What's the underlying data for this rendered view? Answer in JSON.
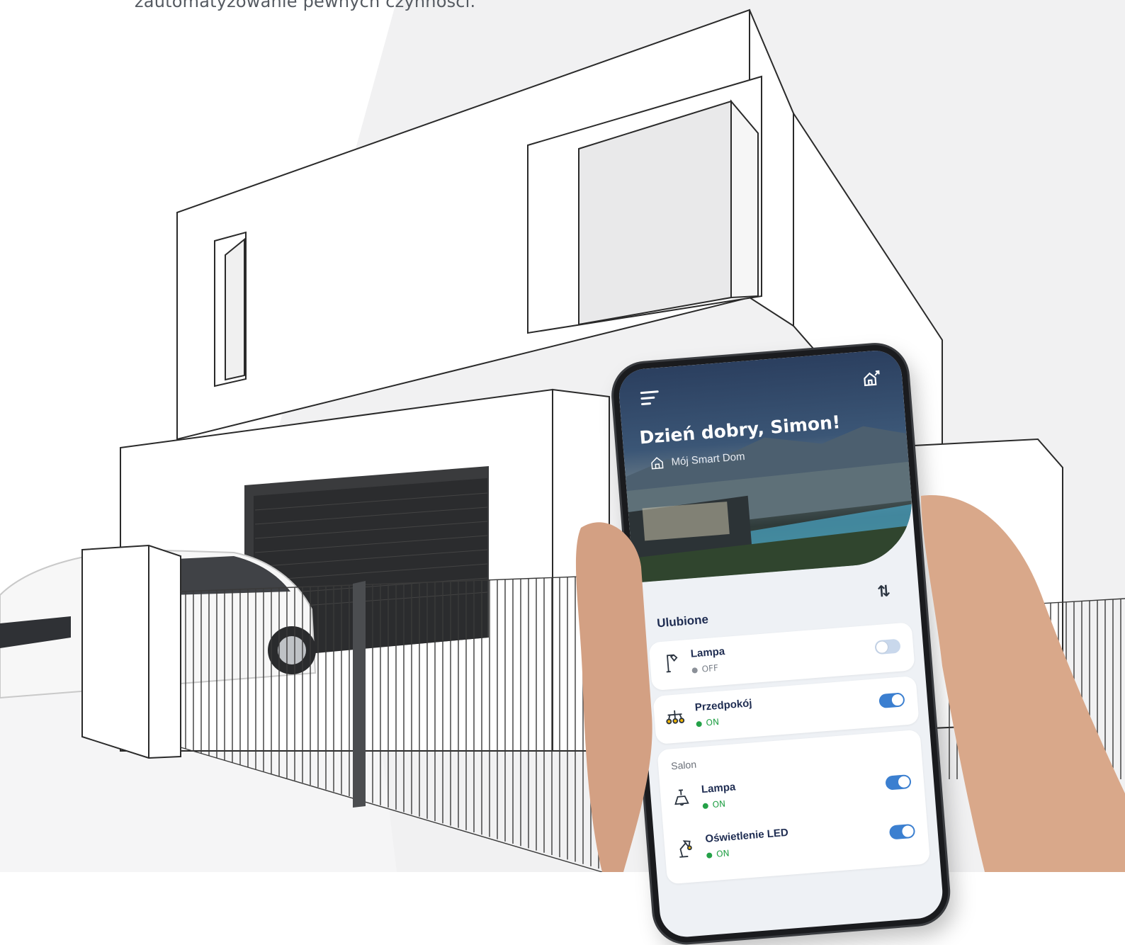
{
  "intro": {
    "text": "zautomatyzowanie pewnych czynności."
  },
  "app": {
    "greeting": "Dzień dobry, Simon!",
    "home_name": "Mój Smart Dom",
    "favorites_title": "Ulubione",
    "icons": {
      "menu": "hamburger-menu-icon",
      "home_share": "home-share-icon",
      "sort": "sort-icon"
    },
    "favorites": [
      {
        "name": "Lampa",
        "status": "OFF",
        "on": false,
        "icon": "floor-lamp-icon"
      },
      {
        "name": "Przedpokój",
        "status": "ON",
        "on": true,
        "icon": "chandelier-icon"
      }
    ],
    "rooms": [
      {
        "room": "Salon",
        "devices": [
          {
            "name": "Lampa",
            "status": "ON",
            "on": true,
            "icon": "ceiling-lamp-icon"
          },
          {
            "name": "Oświetlenie LED",
            "status": "ON",
            "on": true,
            "icon": "desk-lamp-icon"
          }
        ]
      }
    ],
    "colors": {
      "primary": "#1f2d52",
      "toggle_on": "#3b7fd0",
      "toggle_off": "#c9d8ec",
      "status_on": "#24a148"
    }
  }
}
